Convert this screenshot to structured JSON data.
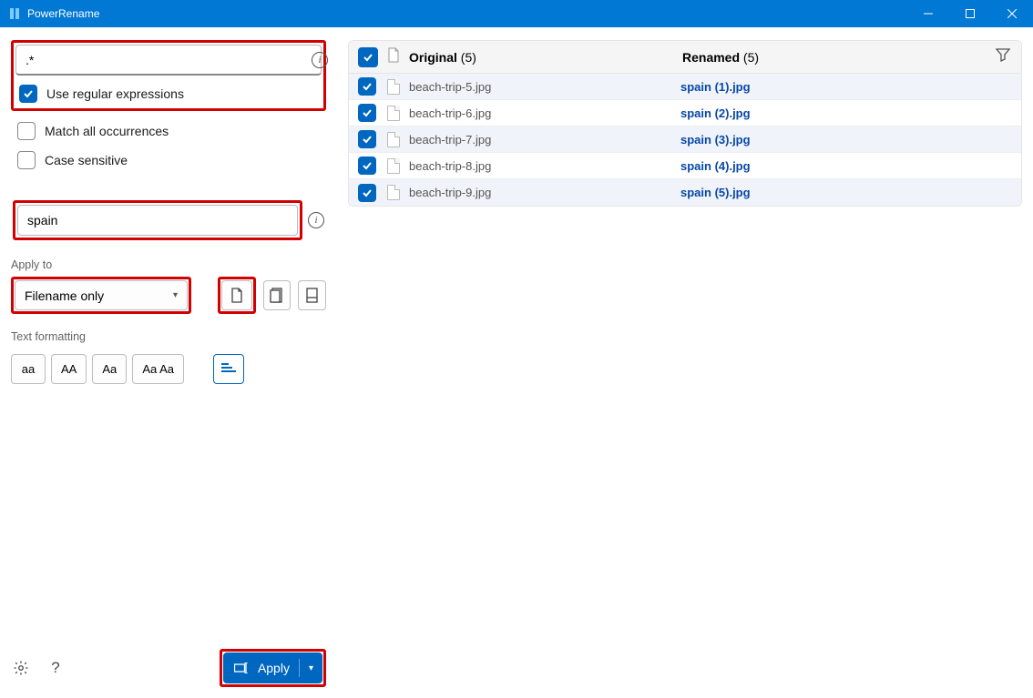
{
  "titlebar": {
    "title": "PowerRename"
  },
  "search": {
    "value": ".*"
  },
  "options": {
    "use_regex": "Use regular expressions",
    "match_all": "Match all occurrences",
    "case_sensitive": "Case sensitive"
  },
  "replace": {
    "value": "spain"
  },
  "apply_to": {
    "label": "Apply to",
    "selected": "Filename only"
  },
  "text_formatting": {
    "label": "Text formatting",
    "btn_lower": "aa",
    "btn_upper": "AA",
    "btn_title": "Aa",
    "btn_cap": "Aa Aa"
  },
  "apply_button": "Apply",
  "table": {
    "header_original": "Original",
    "header_original_count": "(5)",
    "header_renamed": "Renamed",
    "header_renamed_count": "(5)",
    "rows": [
      {
        "original": "beach-trip-5.jpg",
        "renamed": "spain (1).jpg"
      },
      {
        "original": "beach-trip-6.jpg",
        "renamed": "spain (2).jpg"
      },
      {
        "original": "beach-trip-7.jpg",
        "renamed": "spain (3).jpg"
      },
      {
        "original": "beach-trip-8.jpg",
        "renamed": "spain (4).jpg"
      },
      {
        "original": "beach-trip-9.jpg",
        "renamed": "spain (5).jpg"
      }
    ]
  }
}
